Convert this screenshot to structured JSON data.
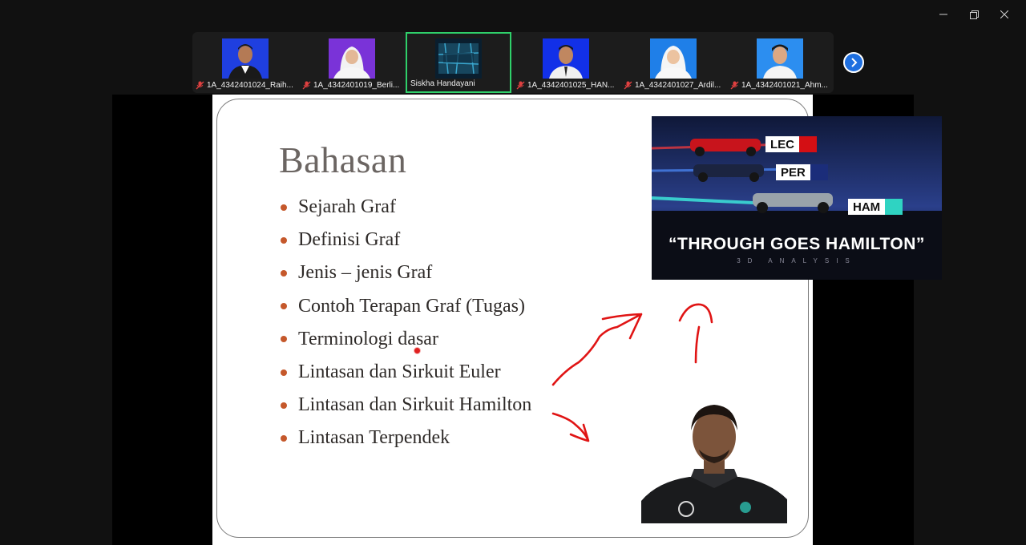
{
  "window": {
    "controls": [
      "minimize",
      "restore",
      "close"
    ]
  },
  "participants": [
    {
      "name": "1A_4342401024_Raih...",
      "muted": true,
      "active": false,
      "avatar": "student-photo"
    },
    {
      "name": "1A_4342401019_Berli...",
      "muted": true,
      "active": false,
      "avatar": "student-photo"
    },
    {
      "name": "Siskha Handayani",
      "muted": false,
      "active": true,
      "avatar": "siskha-logo"
    },
    {
      "name": "1A_4342401025_HAN...",
      "muted": true,
      "active": false,
      "avatar": "student-photo"
    },
    {
      "name": "1A_4342401027_Ardil...",
      "muted": true,
      "active": false,
      "avatar": "student-photo"
    },
    {
      "name": "1A_4342401021_Ahm...",
      "muted": true,
      "active": false,
      "avatar": "student-photo"
    }
  ],
  "slide": {
    "title": "Bahasan",
    "bullets": [
      "Sejarah Graf",
      "Definisi Graf",
      "Jenis – jenis Graf",
      "Contoh Terapan Graf (Tugas)",
      "Terminologi dasar",
      "Lintasan dan Sirkuit Euler",
      "Lintasan dan Sirkuit Hamilton",
      "Lintasan Terpendek"
    ],
    "bullet_color": "#c5582b"
  },
  "f1_card": {
    "drivers": [
      "LEC",
      "PER",
      "HAM"
    ],
    "headline": "“THROUGH GOES HAMILTON”",
    "subtitle": "3D ANALYSIS"
  },
  "colors": {
    "active_border": "#2fd06a",
    "next_button": "#1e6fe0",
    "annotation_ink": "#e01414"
  }
}
